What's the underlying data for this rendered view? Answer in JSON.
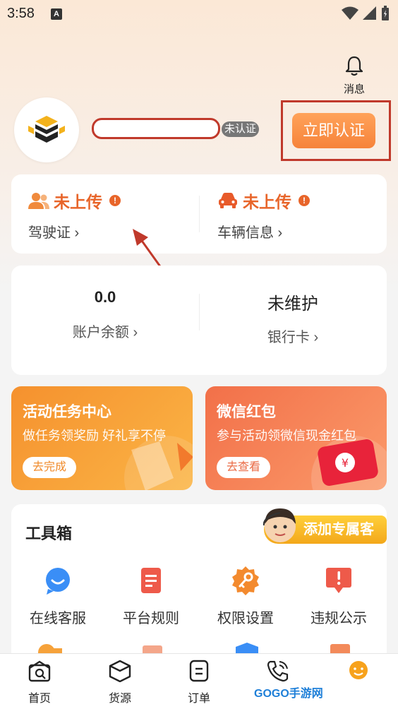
{
  "status_bar": {
    "time": "3:58",
    "notif_badge": "A"
  },
  "header": {
    "messages_label": "消息"
  },
  "profile": {
    "cert_status": "未认证",
    "cert_button": "立即认证"
  },
  "documents": [
    {
      "status": "未上传",
      "label": "驾驶证 ›"
    },
    {
      "status": "未上传",
      "label": "车辆信息 ›"
    }
  ],
  "account": {
    "balance_value": "0.0",
    "balance_label": "账户余额 ›",
    "bank_value": "未维护",
    "bank_label": "银行卡 ›"
  },
  "promos": [
    {
      "title": "活动任务中心",
      "subtitle": "做任务领奖励 好礼享不停",
      "button": "去完成"
    },
    {
      "title": "微信红包",
      "subtitle": "参与活动领微信现金红包",
      "button": "去查看"
    }
  ],
  "toolbox": {
    "title": "工具箱",
    "service_badge": "添加专属客服",
    "tools": [
      {
        "label": "在线客服",
        "icon": "chat-icon",
        "color": "#3a8ef6"
      },
      {
        "label": "平台规则",
        "icon": "document-icon",
        "color": "#ee5a4a"
      },
      {
        "label": "权限设置",
        "icon": "key-gear-icon",
        "color": "#f38a2e"
      },
      {
        "label": "违规公示",
        "icon": "alert-board-icon",
        "color": "#ee5a4a"
      }
    ]
  },
  "tabbar": {
    "tabs": [
      {
        "label": "首页",
        "icon": "home-search-icon"
      },
      {
        "label": "货源",
        "icon": "box-icon"
      },
      {
        "label": "订单",
        "icon": "order-icon"
      },
      {
        "label": "",
        "icon": "phone-icon"
      },
      {
        "label": "",
        "icon": "smile-icon"
      }
    ]
  },
  "watermark": "GOGO手游网"
}
